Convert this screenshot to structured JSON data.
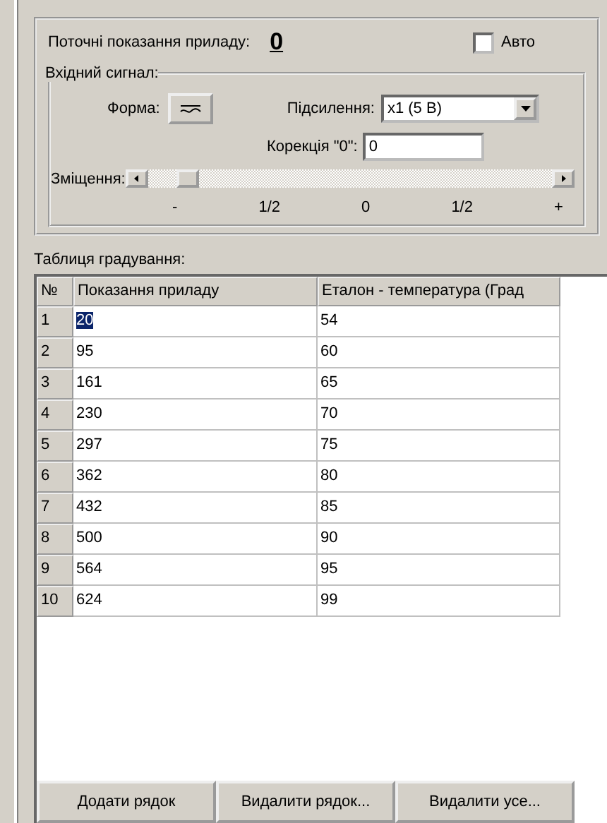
{
  "reading": {
    "label": "Поточні показання приладу:",
    "value": "0"
  },
  "auto": {
    "label": "Авто",
    "checked": false
  },
  "input_signal": {
    "title": "Вхідний сигнал:",
    "shape_label": "Форма:",
    "gain_label": "Підсилення:",
    "gain_value": "x1 (5 B)",
    "zero_label": "Корекція \"0\":",
    "zero_value": "0",
    "offset": {
      "label": "Зміщення:",
      "level": 0.1,
      "ticks": [
        "-",
        "1/2",
        "0",
        "1/2",
        "+"
      ]
    }
  },
  "table": {
    "title": "Таблиця градування:",
    "columns": [
      "№",
      "Показання приладу",
      "Еталон - температура (Град"
    ],
    "rows": [
      {
        "n": "1",
        "reading": "20",
        "reference": "54",
        "selected": true
      },
      {
        "n": "2",
        "reading": "95",
        "reference": "60",
        "selected": false
      },
      {
        "n": "3",
        "reading": "161",
        "reference": "65",
        "selected": false
      },
      {
        "n": "4",
        "reading": "230",
        "reference": "70",
        "selected": false
      },
      {
        "n": "5",
        "reading": "297",
        "reference": "75",
        "selected": false
      },
      {
        "n": "6",
        "reading": "362",
        "reference": "80",
        "selected": false
      },
      {
        "n": "7",
        "reading": "432",
        "reference": "85",
        "selected": false
      },
      {
        "n": "8",
        "reading": "500",
        "reference": "90",
        "selected": false
      },
      {
        "n": "9",
        "reading": "564",
        "reference": "95",
        "selected": false
      },
      {
        "n": "10",
        "reading": "624",
        "reference": "99",
        "selected": false
      }
    ]
  },
  "buttons": [
    "Додати рядок",
    "Видалити рядок...",
    "Видалити усе..."
  ]
}
